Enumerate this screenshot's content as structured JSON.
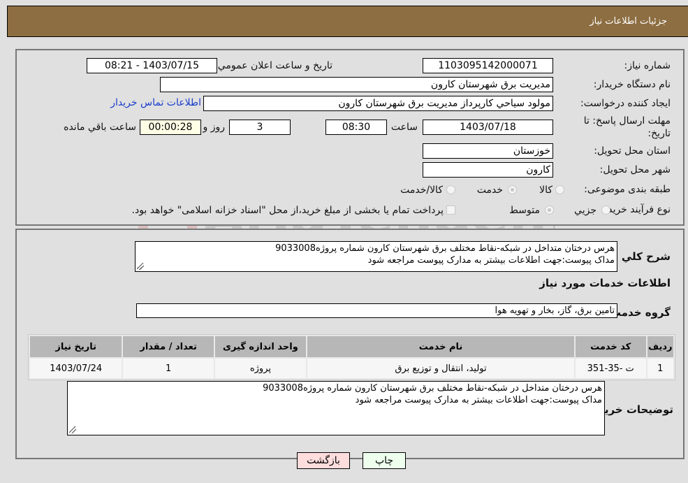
{
  "header": {
    "title": "جزئيات اطلاعات نياز"
  },
  "form": {
    "need_number": {
      "label": "شماره نياز:",
      "value": "1103095142000071"
    },
    "announce_datetime": {
      "label": "تاريخ و ساعت اعلان عمومي:",
      "value": "1403/07/15 - 08:21"
    },
    "buyer_org": {
      "label": "نام دستگاه خريدار:",
      "value": "مديريت برق شهرستان كارون"
    },
    "requester": {
      "label": "ايجاد كننده درخواست:",
      "value": "مولود سياحي كارپرداز مديريت برق شهرستان كارون"
    },
    "buyer_contact_link": "اطلاعات تماس خريدار",
    "deadline": {
      "label_line1": "مهلت ارسال پاسخ: تا",
      "label_line2": "تاريخ:",
      "date": "1403/07/18",
      "time_label": "ساعت",
      "time": "08:30",
      "days": "3",
      "days_label": "روز و",
      "remaining": "00:00:28",
      "remaining_label": "ساعت باقي مانده"
    },
    "province": {
      "label": "استان محل تحويل:",
      "value": "خوزستان"
    },
    "city": {
      "label": "شهر محل تحويل:",
      "value": "كارون"
    },
    "category": {
      "label": "طبقه بندی موضوعی:",
      "options": [
        "كالا",
        "خدمت",
        "كالا/خدمت"
      ],
      "selected": "خدمت"
    },
    "purchase_type": {
      "label": "نوع فرآيند خريد :",
      "options": [
        "جزيي",
        "متوسط"
      ],
      "selected": "متوسط",
      "treasury_note": "پرداخت تمام يا بخشی از مبلغ خريد،از محل \"اسناد خزانه اسلامی\" خواهد بود."
    }
  },
  "details": {
    "summary_label": "شرح كلي نياز:",
    "summary_line1": "هرس درختان متداخل در شبکه-نقاط مختلف برق شهرستان کارون شماره پروژه9033008",
    "summary_line2": "مداک پیوست:جهت اطلاعات بیشتر به مدارک پیوست مراجعه شود",
    "services_heading": "اطلاعات خدمات مورد نياز",
    "service_group_label": "گروه خدمت:",
    "service_group_value": "تامين برق، گاز، بخار و تهويه هوا",
    "table": {
      "headers": [
        "رديف",
        "كد خدمت",
        "نام خدمت",
        "واحد اندازه گيری",
        "تعداد / مقدار",
        "تاريخ نياز"
      ],
      "rows": [
        [
          "1",
          "ت -35-351",
          "توليد، انتقال و توزيع برق",
          "پروژه",
          "1",
          "1403/07/24"
        ]
      ]
    },
    "buyer_notes_label": "توضيحات خريدار:",
    "buyer_notes_line1": "هرس درختان متداخل در شبکه-نقاط مختلف برق شهرستان کارون شماره پروژه9033008",
    "buyer_notes_line2": "مداک پیوست:جهت اطلاعات بیشتر به مدارک پیوست مراجعه شود"
  },
  "buttons": {
    "print": "چاپ",
    "back": "بازگشت"
  },
  "colors": {
    "header_bg": "#8d6e42",
    "link": "#1a3ccc",
    "print_bg": "#eeffee",
    "back_bg": "#ffdddd"
  },
  "watermark": {
    "text": "AriaTender.neT"
  }
}
